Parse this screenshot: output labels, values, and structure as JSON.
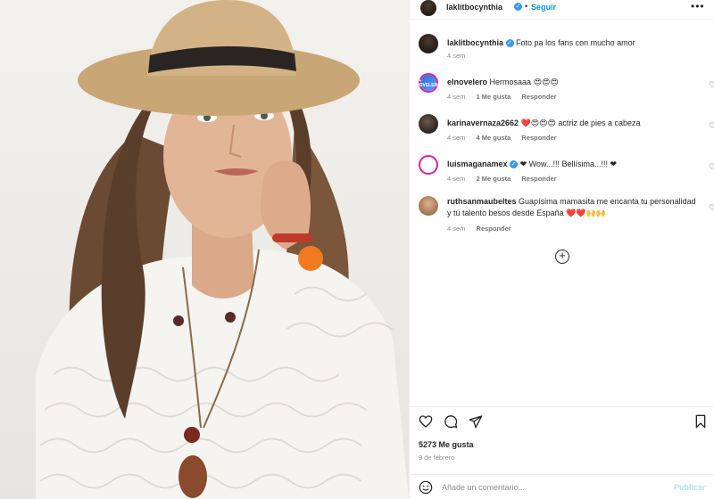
{
  "post": {
    "username": "laklitbocynthia",
    "follow_label": "Seguir",
    "more_glyph": "•••",
    "separator": "•",
    "verified_glyph": "✓",
    "caption": "Foto pa los fans con mucho amor",
    "caption_time": "4 sem"
  },
  "comments": [
    {
      "username": "elnovelero",
      "avatar_text": "EL NOVELERO",
      "text": "Hermosaaa 😍😍😍",
      "time": "4 sem",
      "likes": "1 Me gusta",
      "reply": "Responder",
      "verified": false
    },
    {
      "username": "karinavernaza2662",
      "text": "❤️😍😍😍 actriz de pies a cabeza",
      "time": "4 sem",
      "likes": "4 Me gusta",
      "reply": "Responder",
      "verified": false
    },
    {
      "username": "luismaganamex",
      "text": "❤ Wow...!!! Bellísima...!!! ❤",
      "time": "4 sem",
      "likes": "2 Me gusta",
      "reply": "Responder",
      "verified": true
    },
    {
      "username": "ruthsanmaubeltes",
      "text": "Guapísima mamasita me encanta tu personalidad y tú talento besos desde España ❤️❤️🙌🙌",
      "time": "4 sem",
      "likes": "",
      "reply": "Responder",
      "verified": false
    }
  ],
  "load_more_glyph": "+",
  "heart_glyph": "♡",
  "likes_count": "5273 Me gusta",
  "post_date": "9 de febrero",
  "add_comment": {
    "placeholder": "Añade un comentario...",
    "publish_label": "Publicar"
  },
  "icons": {
    "like": "heart-outline",
    "comment": "speech-bubble",
    "share": "paper-plane",
    "save": "bookmark",
    "emoji": "smiley-face"
  },
  "colors": {
    "link_blue": "#0095f6",
    "verified_blue": "#3797f0",
    "muted_text": "#8e8e8e",
    "publish_disabled": "#b2dffc"
  }
}
